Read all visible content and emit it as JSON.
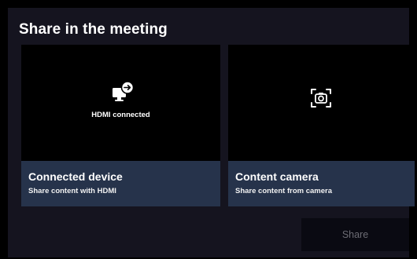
{
  "dialog": {
    "title": "Share in the meeting",
    "share_button_label": "Share"
  },
  "cards": [
    {
      "id": "connected-device",
      "preview_label": "HDMI connected",
      "title": "Connected device",
      "subtitle": "Share content with HDMI",
      "icon": "hdmi-monitor-arrow-icon"
    },
    {
      "id": "content-camera",
      "title": "Content camera",
      "subtitle": "Share content from camera",
      "icon": "camera-frame-icon"
    }
  ],
  "colors": {
    "background": "#000000",
    "panel": "#15141f",
    "caption_band": "#26334b",
    "share_button_bg": "#0a0a12",
    "share_button_text": "#6c6c74"
  }
}
